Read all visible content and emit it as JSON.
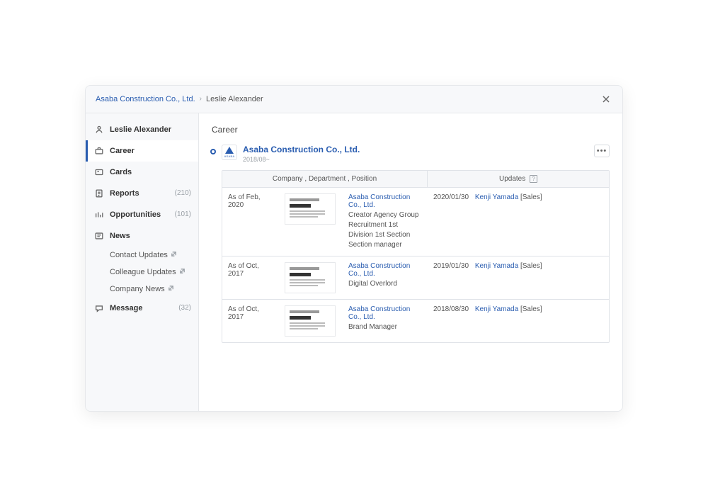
{
  "breadcrumb": {
    "parent": "Asaba Construction Co., Ltd.",
    "current": "Leslie Alexander"
  },
  "sidebar": {
    "items": [
      {
        "icon": "person",
        "label": "Leslie Alexander",
        "count": ""
      },
      {
        "icon": "briefcase",
        "label": "Career",
        "count": ""
      },
      {
        "icon": "card",
        "label": "Cards",
        "count": ""
      },
      {
        "icon": "report",
        "label": "Reports",
        "count": "(210)"
      },
      {
        "icon": "chart",
        "label": "Opportunities",
        "count": "(101)"
      },
      {
        "icon": "news",
        "label": "News",
        "count": ""
      },
      {
        "icon": "message",
        "label": "Message",
        "count": "(32)"
      }
    ],
    "news_sub": [
      "Contact Updates",
      "Colleague Updates",
      "Company News"
    ]
  },
  "main": {
    "title": "Career",
    "company": {
      "name": "Asaba Construction Co., Ltd.",
      "since": "2018/08~",
      "logo_text": "ASABA"
    },
    "table": {
      "header_left": "Company , Department , Position",
      "header_right": "Updates",
      "rows": [
        {
          "asof": "As of Feb, 2020",
          "company": "Asaba Construction Co., Ltd.",
          "line1": "Creator Agency Group Recruitment 1st",
          "line2": "Division 1st Section",
          "line3": "Section manager",
          "update_date": "2020/01/30",
          "update_person": "Kenji Yamada",
          "update_dept": "[Sales]"
        },
        {
          "asof": "As of Oct, 2017",
          "company": "Asaba Construction Co., Ltd.",
          "line1": "Digital Overlord",
          "line2": "",
          "line3": "",
          "update_date": "2019/01/30",
          "update_person": "Kenji Yamada",
          "update_dept": "[Sales]"
        },
        {
          "asof": "As of Oct, 2017",
          "company": "Asaba Construction Co., Ltd.",
          "line1": "Brand Manager",
          "line2": "",
          "line3": "",
          "update_date": "2018/08/30",
          "update_person": "Kenji Yamada",
          "update_dept": "[Sales]"
        }
      ]
    }
  }
}
